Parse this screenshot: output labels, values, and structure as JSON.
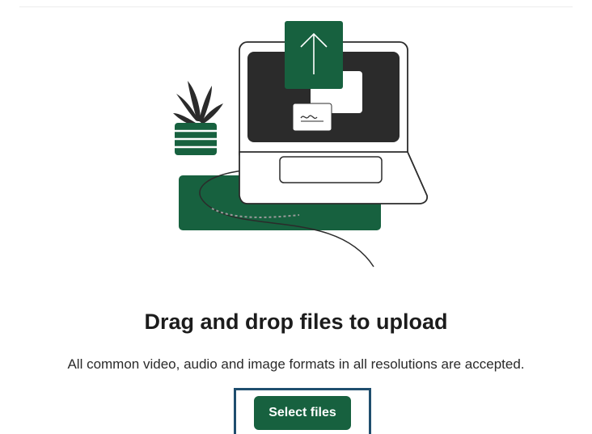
{
  "dropzone": {
    "title": "Drag and drop files to upload",
    "subtitle": "All common video, audio and image formats in all resolutions are accepted.",
    "select_button_label": "Select files",
    "illustration_icon": "laptop-upload-illustration"
  },
  "colors": {
    "brand_green": "#17613f",
    "screen_dark": "#2b2b2b",
    "focus_ring": "#1f4e6e"
  }
}
